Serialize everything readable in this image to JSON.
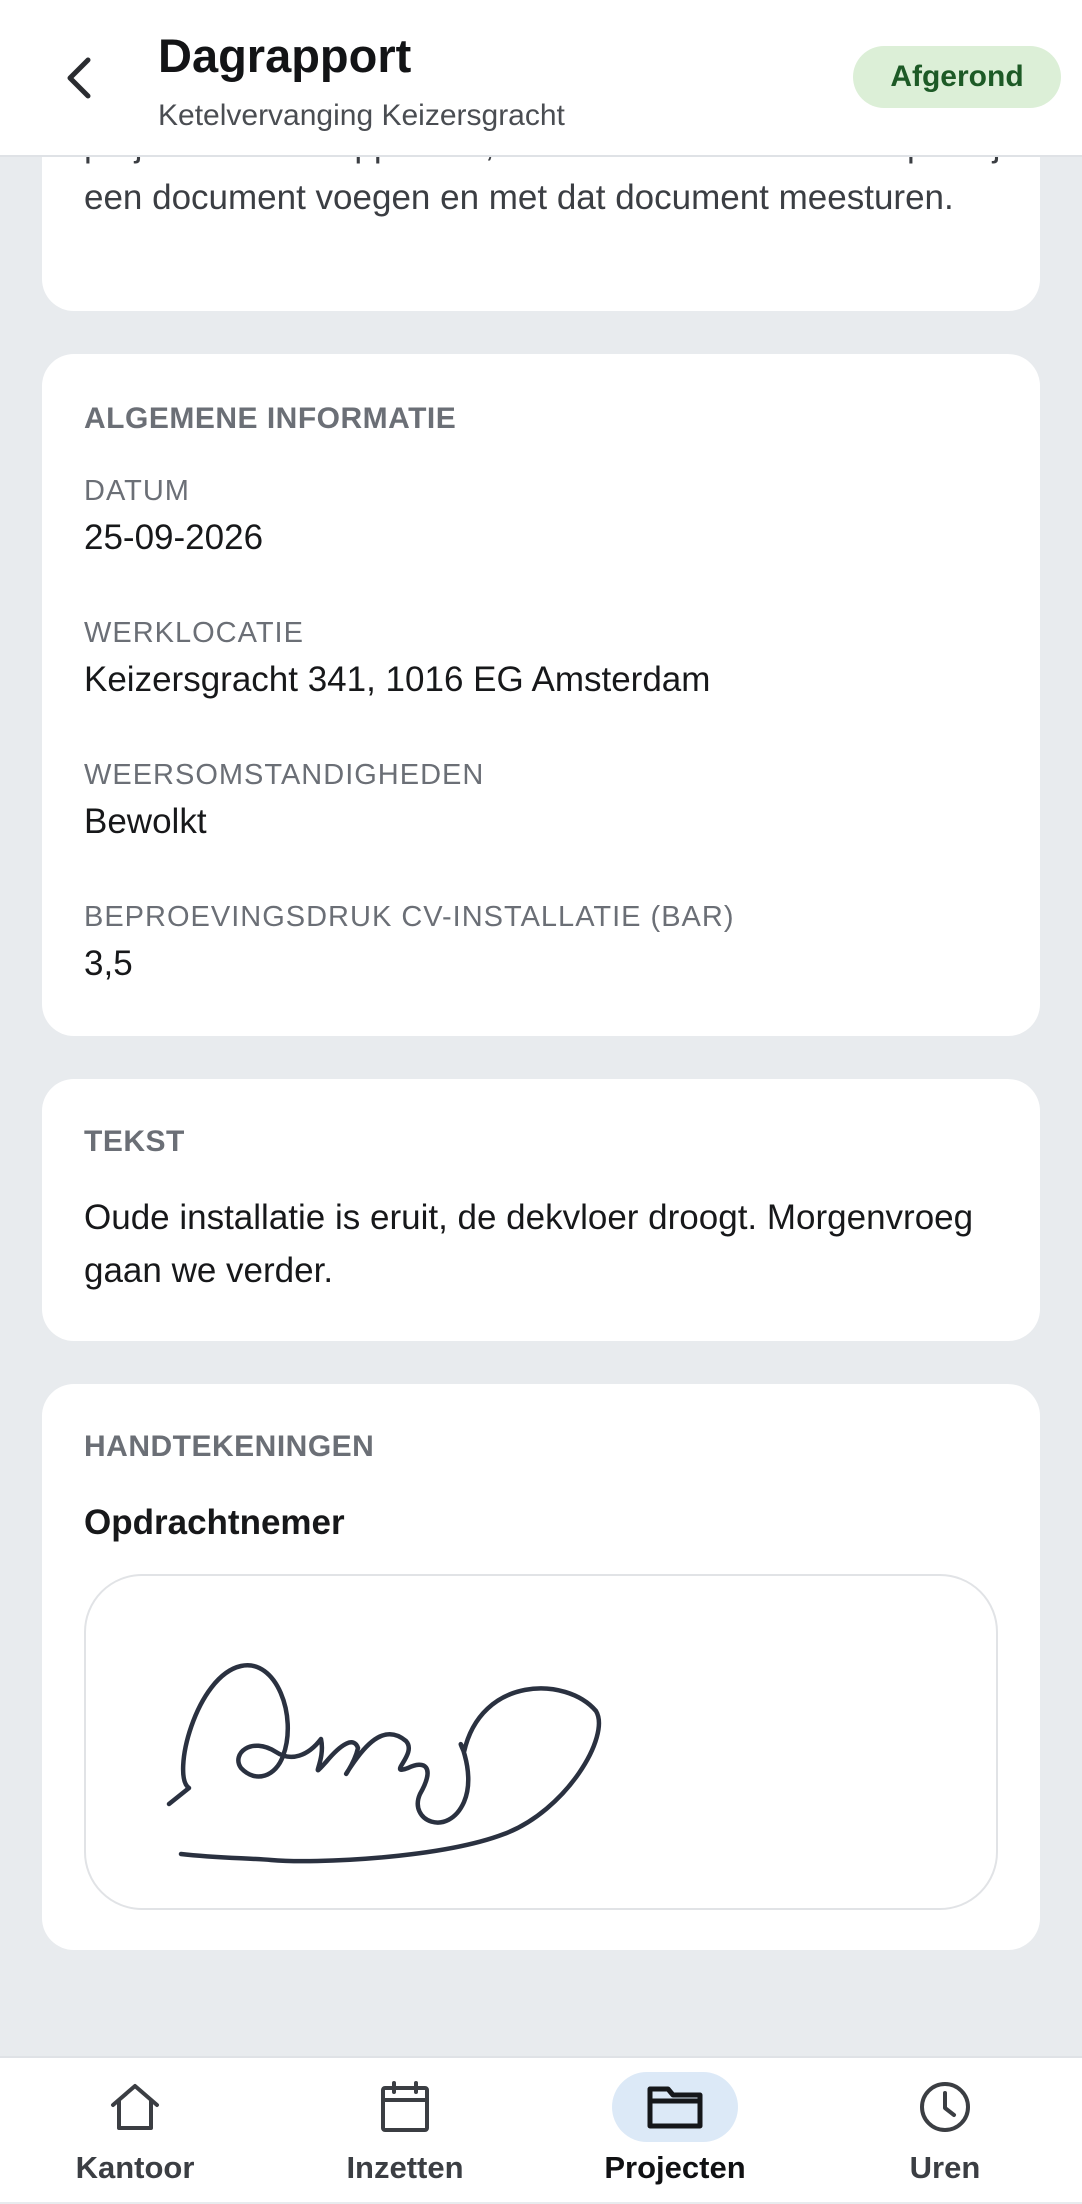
{
  "header": {
    "title": "Dagrapport",
    "subtitle": "Ketelvervanging Keizersgracht",
    "status": "Afgerond",
    "back_icon": "chevron-left-icon"
  },
  "intro": {
    "text": "project onder “Rapporten”, en het kantoor kan ze die pdf bij een document voegen en met dat document meesturen."
  },
  "general_info": {
    "heading": "ALGEMENE INFORMATIE",
    "fields": [
      {
        "label": "DATUM",
        "value": "25-09-2026"
      },
      {
        "label": "WERKLOCATIE",
        "value": "Keizersgracht 341, 1016 EG Amsterdam"
      },
      {
        "label": "WEERSOMSTANDIGHEDEN",
        "value": "Bewolkt"
      },
      {
        "label": "BEPROEVINGSDRUK CV-INSTALLATIE (BAR)",
        "value": "3,5"
      }
    ]
  },
  "text_section": {
    "heading": "TEKST",
    "body": "Oude installatie is eruit, de dekvloer droogt. Morgenvroeg gaan we verder."
  },
  "signatures": {
    "heading": "HANDTEKENINGEN",
    "signer": "Opdrachtnemer"
  },
  "nav": {
    "active": "Projecten",
    "items": [
      {
        "label": "Kantoor",
        "icon": "home-icon"
      },
      {
        "label": "Inzetten",
        "icon": "calendar-icon"
      },
      {
        "label": "Projecten",
        "icon": "folder-icon"
      },
      {
        "label": "Uren",
        "icon": "clock-icon"
      }
    ]
  },
  "colors": {
    "background": "#e8ebee",
    "card": "#ffffff",
    "status_bg": "#dcefd7",
    "status_text": "#1d5a26",
    "active_nav_bg": "#dce9f7",
    "signature_ink": "#2a3140"
  }
}
